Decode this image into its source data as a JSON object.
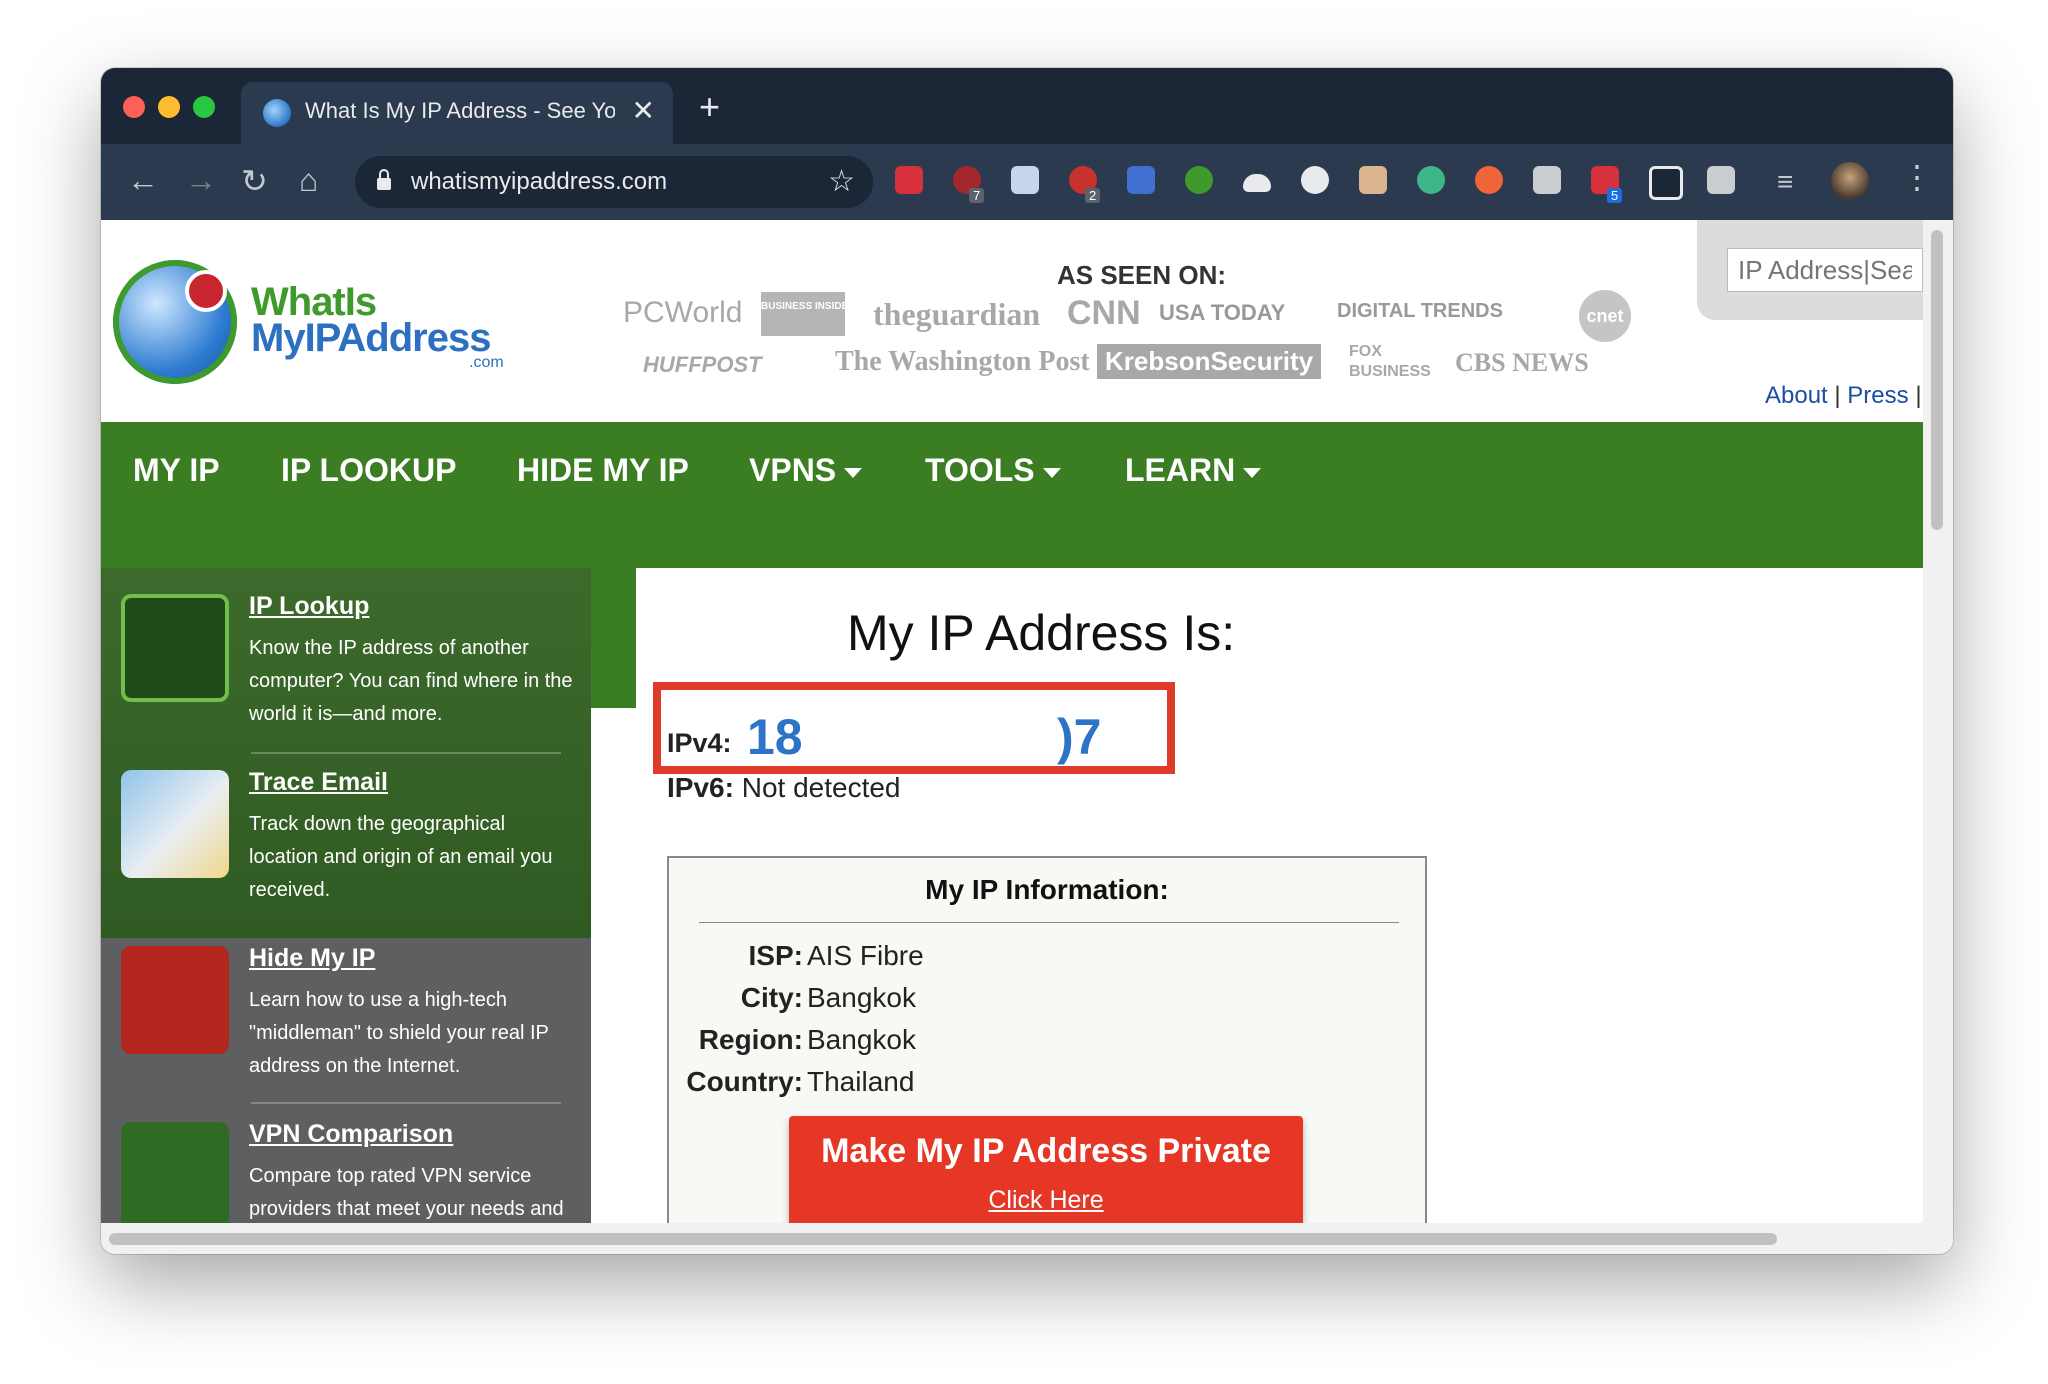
{
  "browser": {
    "tab_title": "What Is My IP Address - See Yo",
    "tab_close": "✕",
    "new_tab": "+",
    "url": "whatismyipaddress.com",
    "back": "←",
    "forward": "→",
    "reload": "↻",
    "home": "⌂",
    "bookmark": "☆",
    "menu": "⋮",
    "ext_badges": [
      "7",
      "2",
      "5"
    ]
  },
  "site": {
    "logo_line1": "WhatIs",
    "logo_line2": "MyIPAddress",
    "logo_suffix": ".com",
    "as_seen_on": "AS SEEN ON:",
    "press_logos": [
      "PCWorld",
      "BUSINESS INSIDER",
      "theguardian",
      "CNN",
      "USA TODAY",
      "DIGITAL TRENDS",
      "cnet",
      "HUFFPOST",
      "The Washington Post",
      "KrebsonSecurity",
      "FOX BUSINESS",
      "CBS NEWS"
    ],
    "search_placeholder": "IP Address|Sea",
    "top_links": {
      "about": "About",
      "sep1": " | ",
      "press": "Press",
      "sep2": " |"
    }
  },
  "nav": {
    "items": [
      {
        "label": "MY IP",
        "dropdown": false
      },
      {
        "label": "IP LOOKUP",
        "dropdown": false
      },
      {
        "label": "HIDE MY IP",
        "dropdown": false
      },
      {
        "label": "VPNS",
        "dropdown": true
      },
      {
        "label": "TOOLS",
        "dropdown": true
      },
      {
        "label": "LEARN",
        "dropdown": true
      }
    ]
  },
  "sidebar": {
    "items": [
      {
        "title": "IP Lookup",
        "desc": "Know the IP address of another computer? You can find where in the world it is—and more."
      },
      {
        "title": "Trace Email",
        "desc": "Track down the geographical location and origin of an email you received."
      },
      {
        "title": "Hide My IP",
        "desc": "Learn how to use a high-tech \"middleman\" to shield your real IP address on the Internet."
      },
      {
        "title": "VPN Comparison",
        "desc": "Compare top rated VPN service providers that meet your needs and budget."
      }
    ]
  },
  "main": {
    "title": "My IP Address Is:",
    "ipv4_label": "IPv4:",
    "ipv4_visible_start": "18",
    "ipv4_visible_end": ")7",
    "ipv6_label": "IPv6:",
    "ipv6_value": "Not detected",
    "info": {
      "title": "My IP Information:",
      "rows": [
        {
          "key": "ISP:",
          "value": "AIS Fibre"
        },
        {
          "key": "City:",
          "value": "Bangkok"
        },
        {
          "key": "Region:",
          "value": "Bangkok"
        },
        {
          "key": "Country:",
          "value": "Thailand"
        }
      ]
    },
    "private_button": "Make My IP Address Private",
    "private_link": "Click Here"
  },
  "colors": {
    "nav_green": "#3a7d22",
    "ip_blue": "#2d73c6",
    "cta_red": "#e63626",
    "highlight_red": "#e03a2a"
  }
}
